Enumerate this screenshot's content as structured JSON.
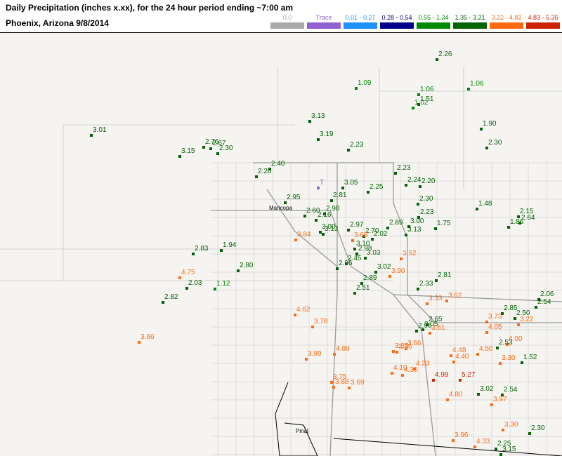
{
  "header": {
    "title": "Daily Precipitation (inches  x.xx),  for the 24 hour period ending ~7:00 am",
    "subtitle": "Phoenix, Arizona  9/8/2014"
  },
  "legend": [
    {
      "label": "0.0",
      "color": "#a9a9a9"
    },
    {
      "label": "Trace",
      "color": "#9060d0"
    },
    {
      "label": "0.01 - 0.27",
      "color": "#1e90ff"
    },
    {
      "label": "0.28 - 0.54",
      "color": "#00008b"
    },
    {
      "label": "0.55 - 1.34",
      "color": "#008800"
    },
    {
      "label": "1.35 - 3.21",
      "color": "#006400"
    },
    {
      "label": "3.22 - 4.82",
      "color": "#ff6a10"
    },
    {
      "label": "4.83 - 5.35",
      "color": "#cc2200"
    }
  ],
  "map": {
    "places": [
      "Maricopa",
      "Pinal"
    ],
    "stations": [
      "2.26",
      "1.09",
      "1.06",
      "1.06",
      "1.51",
      "1.02",
      "3.13",
      "1.90",
      "3.01",
      "3.19",
      "2.76",
      "2.67",
      "2.30",
      "2.23",
      "2.30",
      "3.15",
      "2.40",
      "2.23",
      "2.20",
      "T",
      "3.05",
      "2.24",
      "2.20",
      "2.25",
      "2.95",
      "2.81",
      "2.30",
      "1.48",
      "2.90",
      "2.60",
      "2.16",
      "2.23",
      "2.15",
      "2.64",
      "1.86",
      "3.00",
      "2.97",
      "2.89",
      "3.00",
      "1.75",
      "3.84",
      "3.13",
      "3.13",
      "2.70",
      "3.68",
      "2.02",
      "3.10",
      "2.83",
      "1.94",
      "2.98",
      "3.03",
      "3.52",
      "2.45",
      "2.80",
      "2.96",
      "3.02",
      "4.75",
      "3.90",
      "2.81",
      "2.89",
      "2.03",
      "1.12",
      "2.51",
      "2.33",
      "2.82",
      "3.33",
      "3.62",
      "2.06",
      "2.54",
      "2.85",
      "2.50",
      "3.73",
      "3.22",
      "4.62",
      "2.65",
      "3.78",
      "2.96",
      "3.05",
      "3.61",
      "4.05",
      "3.66",
      "4.00",
      "2.53",
      "3.66",
      "3.35",
      "3.36",
      "4.09",
      "3.99",
      "4.48",
      "4.50",
      "4.40",
      "3.30",
      "1.52",
      "4.23",
      "4.10",
      "4.30",
      "4.99",
      "5.27",
      "3.75",
      "3.88",
      "3.69",
      "3.02",
      "2.54",
      "4.80",
      "3.97",
      "3.30",
      "3.96",
      "2.30",
      "4.33",
      "2.25",
      "3.15"
    ]
  }
}
